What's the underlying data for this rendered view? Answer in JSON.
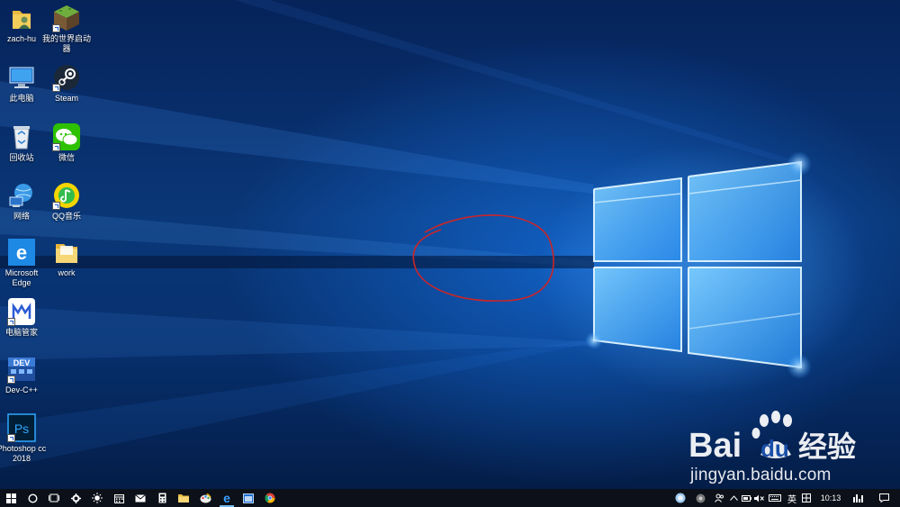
{
  "desktop": {
    "icons": [
      {
        "id": "zach-hu",
        "label": "zach-hu",
        "icon": "user-folder-icon",
        "shortcut": false
      },
      {
        "id": "minecraft",
        "label": "我的世界启动器",
        "icon": "minecraft-grass-block-icon",
        "shortcut": true
      },
      {
        "id": "this-pc",
        "label": "此电脑",
        "icon": "computer-monitor-icon",
        "shortcut": false
      },
      {
        "id": "steam",
        "label": "Steam",
        "icon": "steam-icon",
        "shortcut": true
      },
      {
        "id": "recycle-bin",
        "label": "回收站",
        "icon": "recycle-bin-icon",
        "shortcut": false
      },
      {
        "id": "wechat",
        "label": "微信",
        "icon": "wechat-icon",
        "shortcut": true
      },
      {
        "id": "network",
        "label": "网络",
        "icon": "network-globe-icon",
        "shortcut": false
      },
      {
        "id": "qq-music",
        "label": "QQ音乐",
        "icon": "qq-music-icon",
        "shortcut": true
      },
      {
        "id": "edge",
        "label": "Microsoft Edge",
        "icon": "edge-icon",
        "shortcut": false
      },
      {
        "id": "work",
        "label": "work",
        "icon": "folder-icon",
        "shortcut": false
      },
      {
        "id": "pc-manager",
        "label": "电脑管家",
        "icon": "pc-manager-icon",
        "shortcut": true
      },
      {
        "id": "dev-cpp",
        "label": "Dev-C++",
        "icon": "dev-cpp-icon",
        "shortcut": true
      },
      {
        "id": "photoshop",
        "label": "Photoshop cc 2018",
        "icon": "photoshop-icon",
        "shortcut": true
      }
    ]
  },
  "watermark": {
    "brand": "Bai du 经验",
    "url": "jingyan.baidu.com"
  },
  "taskbar": {
    "left": [
      {
        "id": "start",
        "icon": "windows-logo-icon"
      },
      {
        "id": "search",
        "icon": "cortana-circle-icon"
      },
      {
        "id": "task-view",
        "icon": "task-view-icon"
      },
      {
        "id": "settings",
        "icon": "gear-icon"
      },
      {
        "id": "weather",
        "icon": "sun-icon"
      },
      {
        "id": "calendar",
        "icon": "calendar-icon"
      },
      {
        "id": "mail",
        "icon": "mail-icon"
      },
      {
        "id": "calculator",
        "icon": "calculator-icon"
      },
      {
        "id": "file-explorer",
        "icon": "folder-icon"
      },
      {
        "id": "paint",
        "icon": "paint-palette-icon"
      },
      {
        "id": "edge",
        "icon": "edge-icon",
        "active": true
      },
      {
        "id": "app-window",
        "icon": "window-app-icon"
      },
      {
        "id": "chrome",
        "icon": "chrome-icon"
      }
    ],
    "tray": {
      "ime_lang": "英",
      "time": "10:13"
    }
  }
}
